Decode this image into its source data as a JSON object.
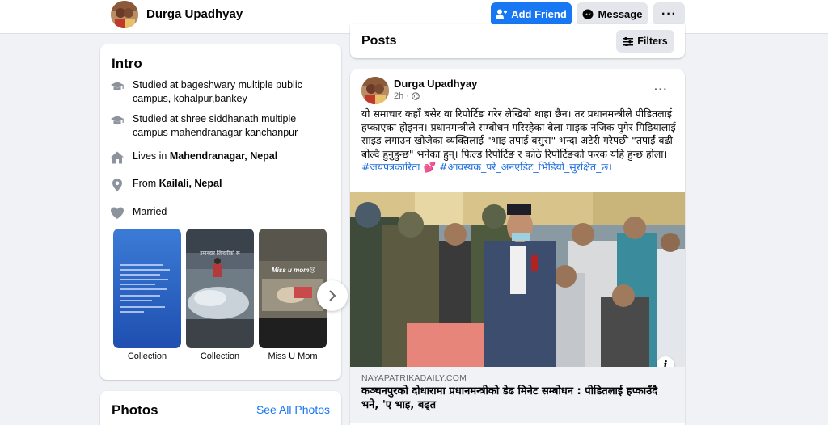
{
  "header": {
    "profile_name": "Durga Upadhyay",
    "add_friend_label": "Add Friend",
    "message_label": "Message",
    "more_icon": "ellipsis-icon"
  },
  "intro": {
    "title": "Intro",
    "items": [
      {
        "icon": "graduation-cap-icon",
        "text": "Studied at bageshwary multiple public campus, kohalpur,bankey"
      },
      {
        "icon": "graduation-cap-icon",
        "text": "Studied at shree siddhanath multiple campus mahendranagar kanchanpur"
      },
      {
        "icon": "home-icon",
        "prefix": "Lives in ",
        "value": "Mahendranagar, Nepal"
      },
      {
        "icon": "location-pin-icon",
        "prefix": "From ",
        "value": "Kailali, Nepal"
      },
      {
        "icon": "heart-icon",
        "text": "Married"
      }
    ],
    "featured": [
      {
        "caption": "Collection"
      },
      {
        "caption": "Collection",
        "overlay_text": "इमानदार जिन्दगीको रू"
      },
      {
        "caption": "Miss U Mom",
        "overlay_text": "Miss u mom😢"
      }
    ]
  },
  "photos": {
    "title": "Photos",
    "see_all": "See All Photos"
  },
  "posts": {
    "title": "Posts",
    "filters_label": "Filters"
  },
  "post": {
    "author": "Durga Upadhyay",
    "time": "2h",
    "separator": "·",
    "body": "यो समाचार कहाँ बसेर वा रिपोर्टिङ गरेर लेखियो थाहा छैन। तर प्रधानमन्त्रीले पीडितलाई हप्काएका होइनन। प्रधानमन्त्रीले सम्बोधन गरिरहेका बेला माइक नजिक पुगेर मिडियालाई साइड लगाउन खोजेका व्यक्तिलाई \"भाइ तपाई बसुस\" भन्दा अटेरी गरेपछी \"तपाईं बढी बोल्दै हुनुहुन्छ\" भनेका हुन्। फिल्ड रिपोर्टिङ र कोठे रिपोर्टिङको फरक यहि हुन्छ होला।",
    "hashtag1": "#जयपत्रकारिता",
    "emoji": "💕",
    "hashtag2": "#आवस्यक_परे_अनएडिट_भिडियो_सुरक्षित_छ।",
    "link_domain": "NAYAPATRIKADAILY.COM",
    "link_title": "कञ्चनपुरको दोधारामा प्रधानमन्त्रीको डेढ मिनेट सम्बोधन : पीडितलाई हप्काउँदै भने, 'ए भाइ, बढ्त"
  },
  "colors": {
    "accent": "#1877f2",
    "background": "#f0f2f5",
    "hashtag": "#216fdb"
  }
}
